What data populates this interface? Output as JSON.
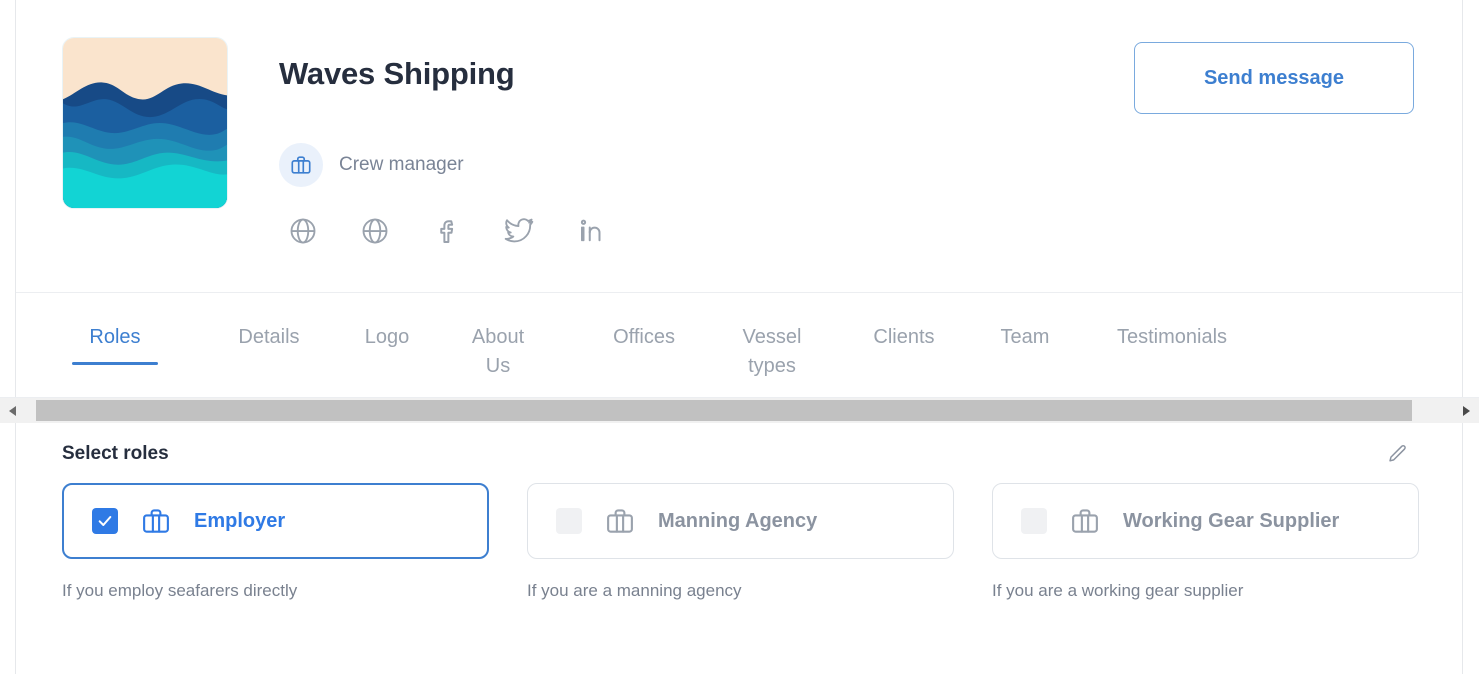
{
  "colors": {
    "accent": "#3d7fd0",
    "checkbox_checked": "#2f7ae5",
    "heading": "#262e3e",
    "muted": "#9aa2ad",
    "border": "#dfe3e8"
  },
  "header": {
    "company_name": "Waves Shipping",
    "logo_alt": "waves-logo",
    "role_badge": {
      "icon": "briefcase-icon",
      "label": "Crew manager"
    },
    "social_links": [
      {
        "icon": "globe-icon",
        "name": "website-link"
      },
      {
        "icon": "globe-icon",
        "name": "secondary-website-link"
      },
      {
        "icon": "facebook-icon",
        "name": "facebook-link"
      },
      {
        "icon": "twitter-icon",
        "name": "twitter-link"
      },
      {
        "icon": "linkedin-icon",
        "name": "linkedin-link"
      }
    ],
    "send_message_label": "Send message"
  },
  "tabs": {
    "active_index": 0,
    "items": [
      {
        "label": "Roles"
      },
      {
        "label": "Details"
      },
      {
        "label": "Logo"
      },
      {
        "label": "About Us"
      },
      {
        "label": "Offices"
      },
      {
        "label": "Vessel types"
      },
      {
        "label": "Clients"
      },
      {
        "label": "Team"
      },
      {
        "label": "Testimonials"
      }
    ]
  },
  "scrollbar": {
    "left_arrow_icon": "triangle-left-icon",
    "right_arrow_icon": "triangle-right-icon"
  },
  "roles_section": {
    "title": "Select roles",
    "edit_icon": "pencil-icon",
    "cards": [
      {
        "label": "Employer",
        "description": "If you employ seafarers directly",
        "icon": "briefcase-icon",
        "checked": true
      },
      {
        "label": "Manning Agency",
        "description": "If you are a manning agency",
        "icon": "briefcase-icon",
        "checked": false
      },
      {
        "label": "Working Gear Supplier",
        "description": "If you are a working gear supplier",
        "icon": "briefcase-icon",
        "checked": false
      }
    ]
  }
}
